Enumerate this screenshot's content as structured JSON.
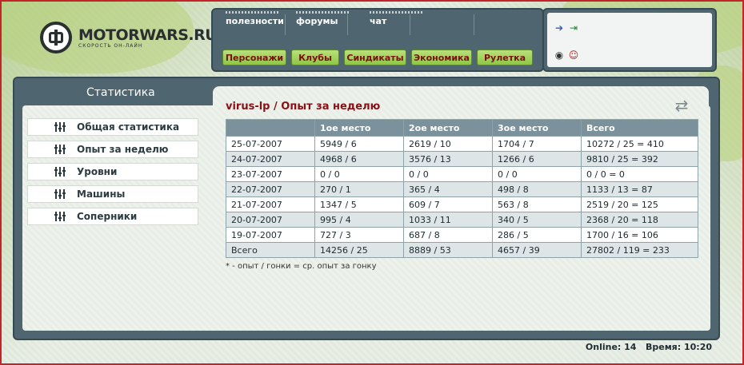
{
  "logo": {
    "title": "MOTORWARS.RU",
    "subtitle": "СКОРОСТЬ ОН-ЛАЙН"
  },
  "top_links": [
    "полезности",
    "форумы",
    "чат"
  ],
  "nav_buttons": [
    "Персонажи",
    "Клубы",
    "Синдикаты",
    "Экономика",
    "Рулетка"
  ],
  "icons": [
    "arrow-icon",
    "exit-icon",
    "globe-icon",
    "user-icon"
  ],
  "sidebar": {
    "title": "Статистика",
    "items": [
      "Общая статистика",
      "Опыт за неделю",
      "Уровни",
      "Машины",
      "Соперники"
    ]
  },
  "content": {
    "heading": "virus-lp / Опыт за неделю",
    "columns": [
      "",
      "1ое место",
      "2ое место",
      "3ое место",
      "Всего"
    ],
    "rows": [
      [
        "25-07-2007",
        "5949 / 6",
        "2619 / 10",
        "1704 / 7",
        "10272 / 25 = 410"
      ],
      [
        "24-07-2007",
        "4968 / 6",
        "3576 / 13",
        "1266 / 6",
        "9810 / 25 = 392"
      ],
      [
        "23-07-2007",
        "0 / 0",
        "0 / 0",
        "0 / 0",
        "0 / 0 = 0"
      ],
      [
        "22-07-2007",
        "270 / 1",
        "365 / 4",
        "498 / 8",
        "1133 / 13 = 87"
      ],
      [
        "21-07-2007",
        "1347 / 5",
        "609 / 7",
        "563 / 8",
        "2519 / 20 = 125"
      ],
      [
        "20-07-2007",
        "995 / 4",
        "1033 / 11",
        "340 / 5",
        "2368 / 20 = 118"
      ],
      [
        "19-07-2007",
        "727 / 3",
        "687 / 8",
        "286 / 5",
        "1700 / 16 = 106"
      ],
      [
        "Всего",
        "14256 / 25",
        "8889 / 53",
        "4657 / 39",
        "27802 / 119 = 233"
      ]
    ],
    "note": "* - опыт / гонки = ср. опыт за гонку"
  },
  "status": {
    "online_label": "Online:",
    "online": "14",
    "time_label": "Время:",
    "time": "10:20"
  },
  "colors": {
    "accent_red": "#8b0f15",
    "panel": "#4f6570",
    "button_green": "#8ec646",
    "table_header": "#7b919b"
  }
}
